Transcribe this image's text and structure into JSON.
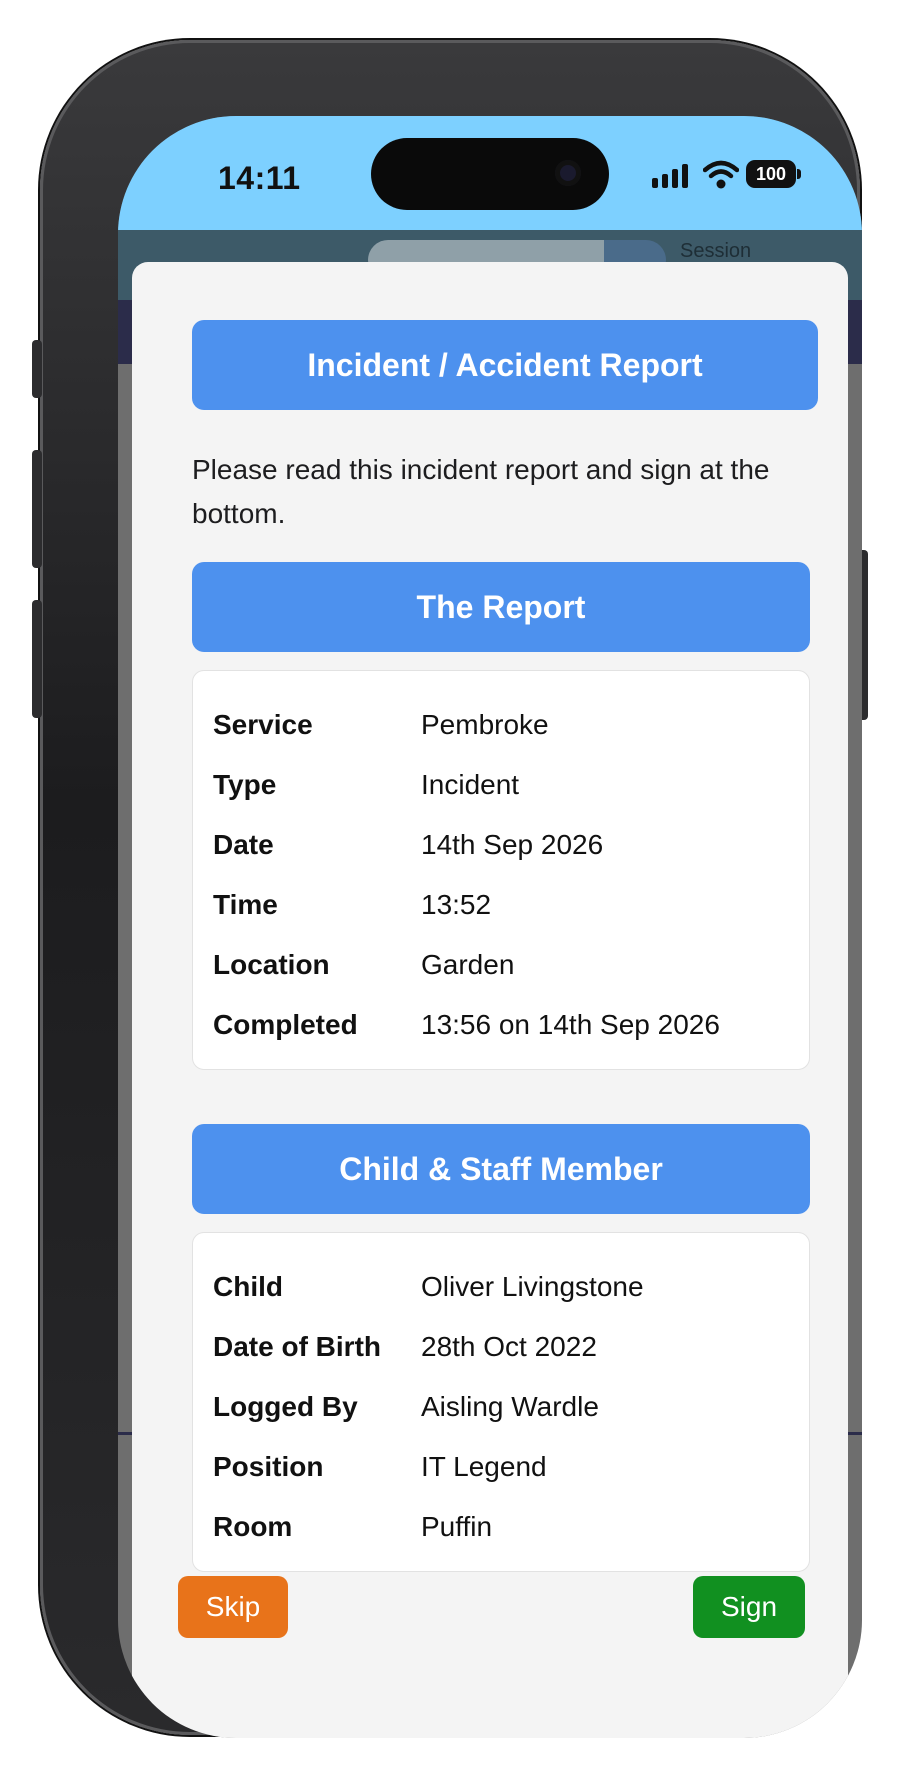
{
  "status_bar": {
    "time": "14:11",
    "battery": "100",
    "icons": [
      "signal-icon",
      "wifi-icon",
      "battery-icon"
    ]
  },
  "background_app": {
    "session_label": "Session"
  },
  "modal": {
    "title": "Incident / Accident Report",
    "intro": "Please read this incident report and sign at the bottom.",
    "report": {
      "heading": "The Report",
      "rows": [
        {
          "label": "Service",
          "value": "Pembroke"
        },
        {
          "label": "Type",
          "value": "Incident"
        },
        {
          "label": "Date",
          "value": "14th Sep 2026"
        },
        {
          "label": "Time",
          "value": "13:52"
        },
        {
          "label": "Location",
          "value": "Garden"
        },
        {
          "label": "Completed",
          "value": "13:56 on 14th Sep 2026"
        }
      ]
    },
    "people": {
      "heading": "Child & Staff Member",
      "rows": [
        {
          "label": "Child",
          "value": "Oliver Livingstone"
        },
        {
          "label": "Date of Birth",
          "value": "28th Oct 2022"
        },
        {
          "label": "Logged By",
          "value": "Aisling Wardle"
        },
        {
          "label": "Position",
          "value": "IT Legend"
        },
        {
          "label": "Room",
          "value": "Puffin"
        }
      ]
    },
    "actions": {
      "skip_label": "Skip",
      "sign_label": "Sign"
    }
  },
  "colors": {
    "banner": "#4d91ee",
    "status_bar": "#7dd0ff",
    "skip": "#e8731a",
    "sign": "#119020"
  }
}
